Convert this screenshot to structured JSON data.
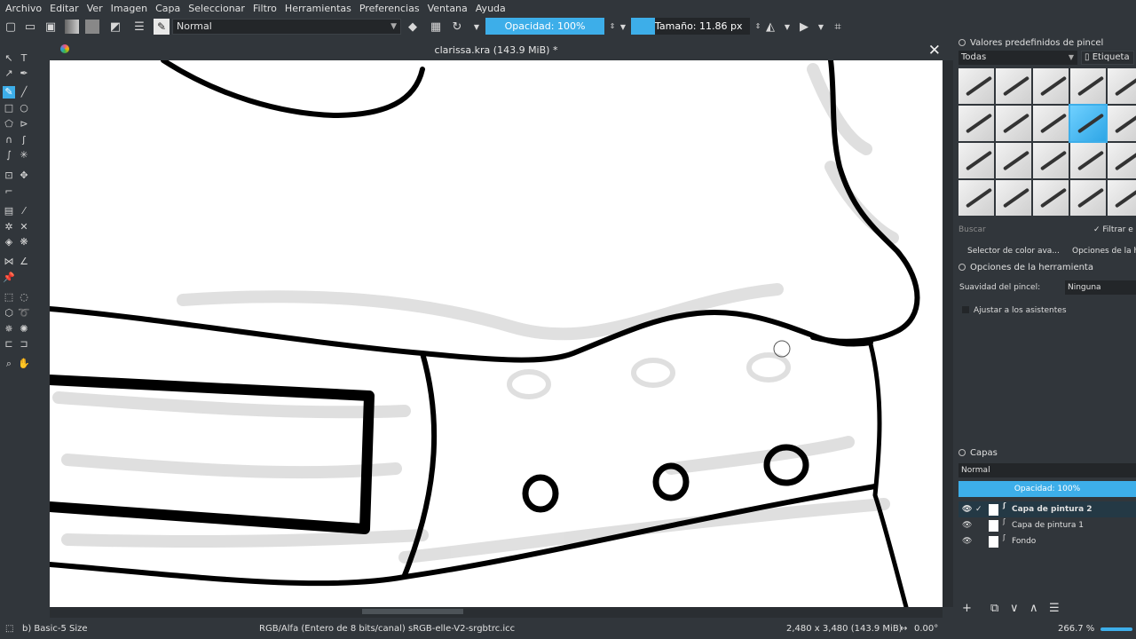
{
  "menu": [
    "Archivo",
    "Editar",
    "Ver",
    "Imagen",
    "Capa",
    "Seleccionar",
    "Filtro",
    "Herramientas",
    "Preferencias",
    "Ventana",
    "Ayuda"
  ],
  "toolbar": {
    "blend_mode": "Normal",
    "opacity_label": "Opacidad: 100%",
    "opacity_value": 1.0,
    "size_label": "Tamaño: 11.86 px",
    "size_fill_fraction": 0.2
  },
  "document": {
    "title": "clarissa.kra (143.9 MiB) *",
    "close_icon": "close-icon"
  },
  "brush_presets": {
    "title": "Valores predefinidos de pincel",
    "filter": "Todas",
    "tag_label": "Etiqueta",
    "search_placeholder": "Buscar",
    "filter_check": "Filtrar e",
    "selected_index": 8
  },
  "dock_tabs": [
    "Selector de color ava...",
    "Opciones de la he"
  ],
  "tool_options": {
    "title": "Opciones de la herramienta",
    "smoothing_label": "Suavidad del pincel:",
    "smoothing_value": "Ninguna",
    "assistant_label": "Ajustar a los asistentes"
  },
  "layers": {
    "title": "Capas",
    "blend_mode": "Normal",
    "opacity_label": "Opacidad:  100%",
    "items": [
      {
        "name": "Capa de pintura 2",
        "active": true
      },
      {
        "name": "Capa de pintura 1",
        "active": false
      },
      {
        "name": "Fondo",
        "active": false
      }
    ]
  },
  "status": {
    "brush": "b) Basic-5 Size",
    "color_model": "RGB/Alfa (Entero de 8 bits/canal)  sRGB-elle-V2-srgbtrc.icc",
    "image_size": "2,480 x 3,480 (143.9 MiB)",
    "rotation": "0.00°",
    "zoom": "266.7 %"
  },
  "colors": {
    "accent": "#3daee9",
    "background": "#31363b",
    "canvas": "#ffffff"
  }
}
